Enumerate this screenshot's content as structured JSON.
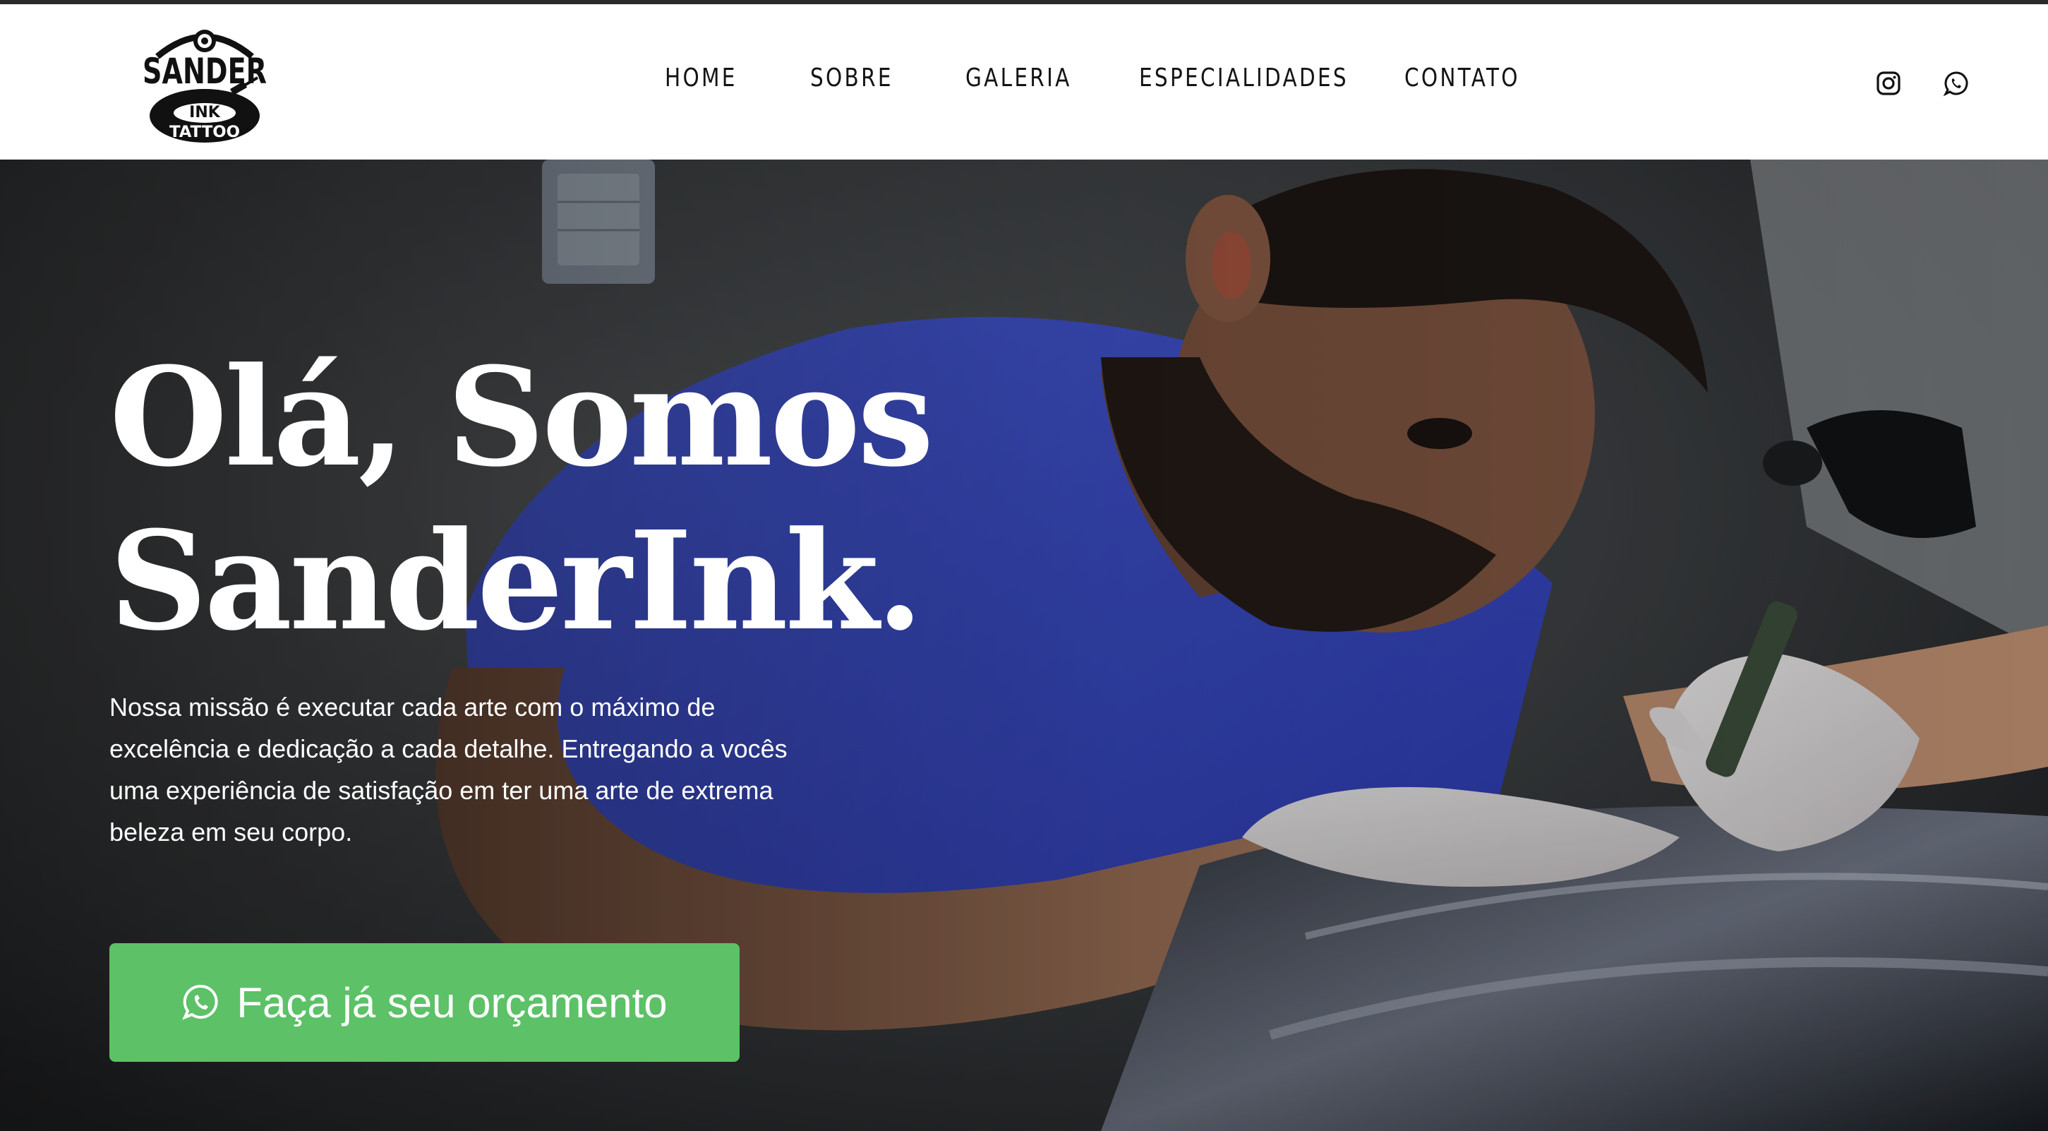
{
  "brand": {
    "logo_top": "SANDER",
    "logo_mid": "INK",
    "logo_bottom": "TATTOO"
  },
  "nav": {
    "items": [
      {
        "label": "HOME"
      },
      {
        "label": "SOBRE"
      },
      {
        "label": "GALERIA"
      },
      {
        "label": "ESPECIALIDADES"
      },
      {
        "label": "CONTATO"
      }
    ]
  },
  "social": {
    "icons": [
      "instagram-icon",
      "whatsapp-icon"
    ]
  },
  "hero": {
    "title_line1": "Olá, Somos",
    "title_line2": "SanderInk.",
    "description": "Nossa missão é executar cada arte com o máximo de excelência e dedicação a cada detalhe. Entregando a vocês uma experiência de satisfação em ter uma arte de extrema beleza em seu corpo.",
    "cta_label": "Faça já seu orçamento",
    "cta_icon": "whatsapp-icon"
  },
  "colors": {
    "cta_green": "#5cc167",
    "nav_text": "#141414",
    "shirt_blue": "#3d4fd0",
    "header_bg": "#ffffff"
  }
}
